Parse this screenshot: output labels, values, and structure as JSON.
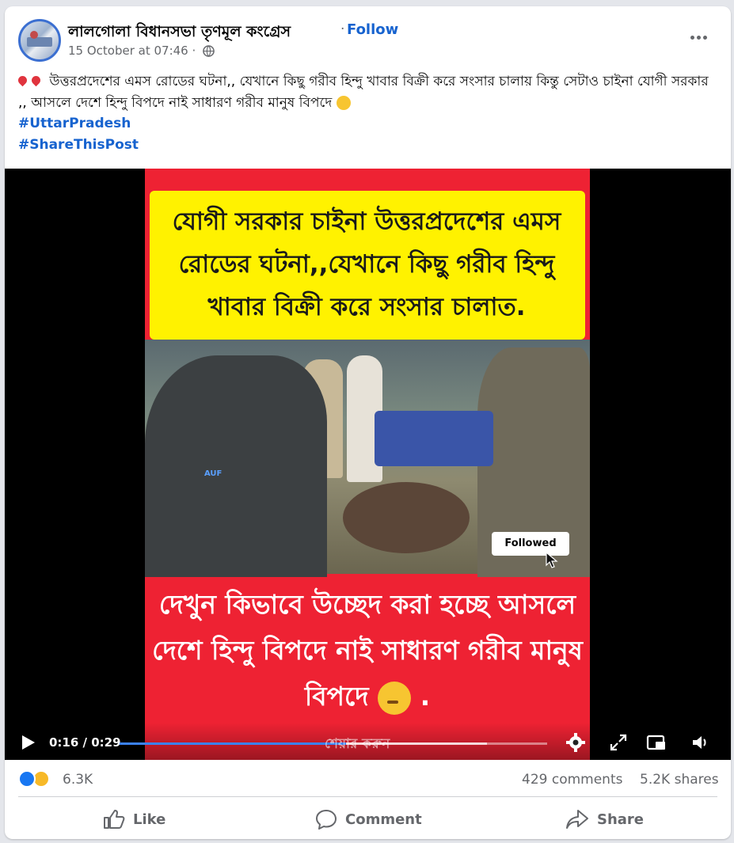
{
  "post": {
    "page_name": "লালগোলা বিধানসভা তৃণমূল কংগ্রেস",
    "separator": "·",
    "follow_label": "Follow",
    "timestamp": "15 October at 07:46 ·",
    "audience_icon": "globe-icon",
    "more_icon": "more-options-icon",
    "text": "উত্তরপ্রদেশের এমস রোডের ঘটনা,, যেখানে কিছু গরীব হিন্দু খাবার বিক্রী করে সংসার চালায় কিন্তু সেটাও চাইনা যোগী সরকার ,, আসলে দেশে হিন্দু বিপদে নাই সাধারণ গরীব মানুষ বিপদে",
    "hashtags": [
      "#UttarPradesh",
      "#ShareThisPost"
    ]
  },
  "video": {
    "top_caption": "যোগী সরকার চাইনা উত্তরপ্রদেশের এমস রোডের ঘটনা,,যেখানে কিছু গরীব হিন্দু খাবার বিক্রী করে সংসার চালাত.",
    "bottom_caption": "দেখুন কিভাবে উচ্ছেদ করা হচ্ছে আসলে দেশে হিন্দু বিপদে নাই সাধারণ গরীব মানুষ বিপদে",
    "bottom_caption_end": ".",
    "watermark": "AUF",
    "followed_label": "Followed",
    "share_overlay": "শেয়ার করুন",
    "time": "0:16 / 0:29",
    "progress": 0.53,
    "buffered": 0.86,
    "accent": "#3b82f6",
    "caption_bg": "#ee2233",
    "caption_highlight": "#fff200"
  },
  "stats": {
    "reactions": [
      "like-icon",
      "sad-icon"
    ],
    "reaction_count": "6.3K",
    "comments": "429 comments",
    "shares": "5.2K shares"
  },
  "actions": {
    "like": "Like",
    "comment": "Comment",
    "share": "Share"
  }
}
